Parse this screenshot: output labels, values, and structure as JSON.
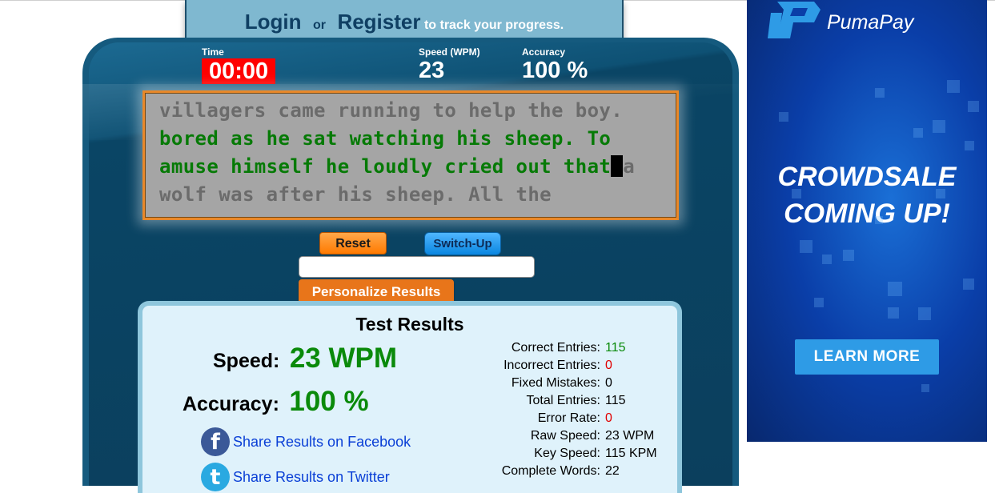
{
  "login_banner": {
    "login": "Login",
    "or": "or",
    "register": "Register",
    "suffix": "to track your progress."
  },
  "stats": {
    "time_label": "Time",
    "time_value": "00:00",
    "speed_label": "Speed (WPM)",
    "speed_value": "23",
    "accuracy_label": "Accuracy",
    "accuracy_value": "100 %"
  },
  "text_box": {
    "line1": "villagers came running to help the boy.",
    "line2": "bored as he sat watching his sheep. To",
    "line3_typed": "amuse himself he loudly cried out that",
    "line3_pending": "a",
    "line4": "wolf was after his sheep. All the"
  },
  "controls": {
    "reset": "Reset",
    "switch_up": "Switch-Up",
    "input_value": "",
    "personalize": "Personalize Results"
  },
  "results": {
    "title": "Test Results",
    "speed_label": "Speed:",
    "speed_value": "23 WPM",
    "accuracy_label": "Accuracy:",
    "accuracy_value": "100 %",
    "share_facebook": "Share Results on Facebook",
    "share_twitter": "Share Results on Twitter",
    "details": [
      {
        "label": "Correct Entries:",
        "value": "115",
        "color": "#0a8a0a"
      },
      {
        "label": "Incorrect Entries:",
        "value": "0",
        "color": "#e00000"
      },
      {
        "label": "Fixed Mistakes:",
        "value": "0",
        "color": "#000000"
      },
      {
        "label": "Total Entries:",
        "value": "115",
        "color": "#000000"
      },
      {
        "label": "Error Rate:",
        "value": "0",
        "color": "#e00000"
      },
      {
        "label": "Raw Speed:",
        "value": "23 WPM",
        "color": "#000000"
      },
      {
        "label": "Key Speed:",
        "value": "115 KPM",
        "color": "#000000"
      },
      {
        "label": "Complete Words:",
        "value": "22",
        "color": "#000000"
      }
    ]
  },
  "ad": {
    "brand": "PumaPay",
    "headline1": "CROWDSALE",
    "headline2": "COMING UP!",
    "button": "LEARN MORE"
  }
}
